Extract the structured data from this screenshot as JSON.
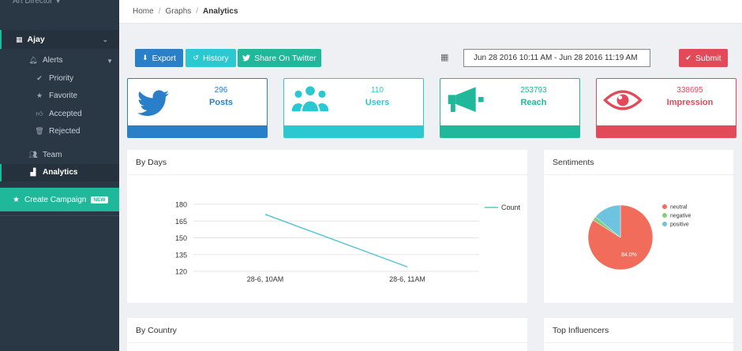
{
  "sidebar": {
    "role": "Art Director",
    "user": "Ajay",
    "items": [
      {
        "label": "Alerts",
        "icon": "bell-icon"
      },
      {
        "label": "Priority",
        "icon": "check-icon"
      },
      {
        "label": "Favorite",
        "icon": "star-icon"
      },
      {
        "label": "Accepted",
        "icon": "thumbs-up-icon"
      },
      {
        "label": "Rejected",
        "icon": "trash-icon"
      },
      {
        "label": "Team",
        "icon": "users-icon"
      },
      {
        "label": "Analytics",
        "icon": "bar-chart-icon"
      }
    ],
    "campaign": {
      "label": "Create Campaign",
      "badge": "NEW"
    }
  },
  "breadcrumb": [
    "Home",
    "Graphs",
    "Analytics"
  ],
  "toolbar": {
    "export_label": "Export",
    "history_label": "History",
    "share_label": "Share On Twitter",
    "submit_label": "Submit",
    "daterange": "Jun 28 2016 10:11 AM  - Jun 28 2016 11:19 AM"
  },
  "stats": [
    {
      "value": "296",
      "label": "Posts",
      "color": "#2980c9"
    },
    {
      "value": "110",
      "label": "Users",
      "color": "#2ac8d0"
    },
    {
      "value": "253793",
      "label": "Reach",
      "color": "#1fb89a"
    },
    {
      "value": "338695",
      "label": "Impression",
      "color": "#e24a5a"
    }
  ],
  "panels": {
    "by_days": "By Days",
    "sentiments": "Sentiments",
    "by_country": "By Country",
    "top_influencers": "Top Influencers"
  },
  "chart_data": [
    {
      "type": "line",
      "categories": [
        "28-6, 10AM",
        "28-6, 11AM"
      ],
      "series": [
        {
          "name": "Count",
          "values": [
            171,
            124
          ],
          "color": "#5bc4d6"
        }
      ],
      "yticks": [
        120,
        135,
        150,
        165,
        180
      ],
      "ylim": [
        120,
        180
      ],
      "legend": "right",
      "grid": true
    },
    {
      "type": "pie",
      "slices": [
        {
          "name": "neutral",
          "value": 84.0,
          "color": "#f26c5b"
        },
        {
          "name": "negative",
          "value": 2.0,
          "color": "#7fcf7a"
        },
        {
          "name": "positive",
          "value": 14.0,
          "color": "#6ec4e0"
        }
      ],
      "data_label": "84.0%",
      "legend": "right"
    }
  ]
}
